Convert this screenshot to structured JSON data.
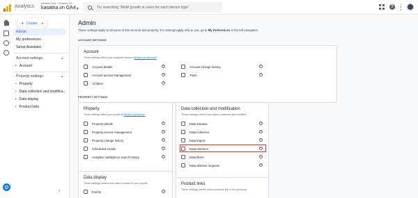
{
  "header": {
    "app_name": "Analytics",
    "account_path": "Kasatria GA4 > Kasatria GA",
    "property_name": "kasatria.vn GA4",
    "search_placeholder": "Try searching \"MoM growth in users for each device type\""
  },
  "sidebar": {
    "create_label": "Create",
    "items": [
      {
        "label": "Admin",
        "active": true
      },
      {
        "label": "My preferences",
        "active": false
      },
      {
        "label": "Setup Assistant",
        "active": false
      }
    ],
    "account_settings_label": "Account settings",
    "account_sub": [
      "Account"
    ],
    "property_settings_label": "Property settings",
    "property_sub": [
      "Property",
      "Data collection and modifica...",
      "Data display",
      "Product links"
    ]
  },
  "main": {
    "title": "Admin",
    "description_prefix": "These settings apply to all users of this account and property. For settings apply only to you, go to ",
    "description_bold": "My Preferences",
    "description_suffix": " in the left navigation.",
    "account_section_label": "ACCOUNT SETTINGS",
    "property_section_label": "PROPERTY SETTINGS",
    "account_card": {
      "title": "Account",
      "subtitle": "These settings affect your analytics account",
      "subtitle_link": "What's an account?",
      "left_items": [
        "Account details",
        "Account access management",
        "All filters"
      ],
      "right_items": [
        "Account change history",
        "Trash"
      ]
    },
    "property_card": {
      "title": "Property",
      "subtitle": "These settings affect your property",
      "subtitle_link": "What's a property?",
      "items": [
        "Property details",
        "Property access management",
        "Property change history",
        "Scheduled emails",
        "Analytics Intelligence search history"
      ]
    },
    "data_card": {
      "title": "Data collection and modification",
      "subtitle": "These settings control how data is collected and modified",
      "items": [
        "Data streams",
        "Data collection",
        "Data import",
        "Data retention",
        "Data filters",
        "Data deletion requests"
      ],
      "highlighted": "Data retention"
    },
    "display_card": {
      "title": "Data display",
      "subtitle": "These settings control how data is shown in your reports",
      "items": [
        "Events"
      ]
    },
    "links_card": {
      "title": "Product links",
      "subtitle": "These settings control which products link to this property"
    }
  },
  "colors": {
    "accent": "#1a73e8",
    "highlight": "#d93025",
    "logo_orange": "#e37400",
    "logo_yellow": "#f9ab00"
  }
}
